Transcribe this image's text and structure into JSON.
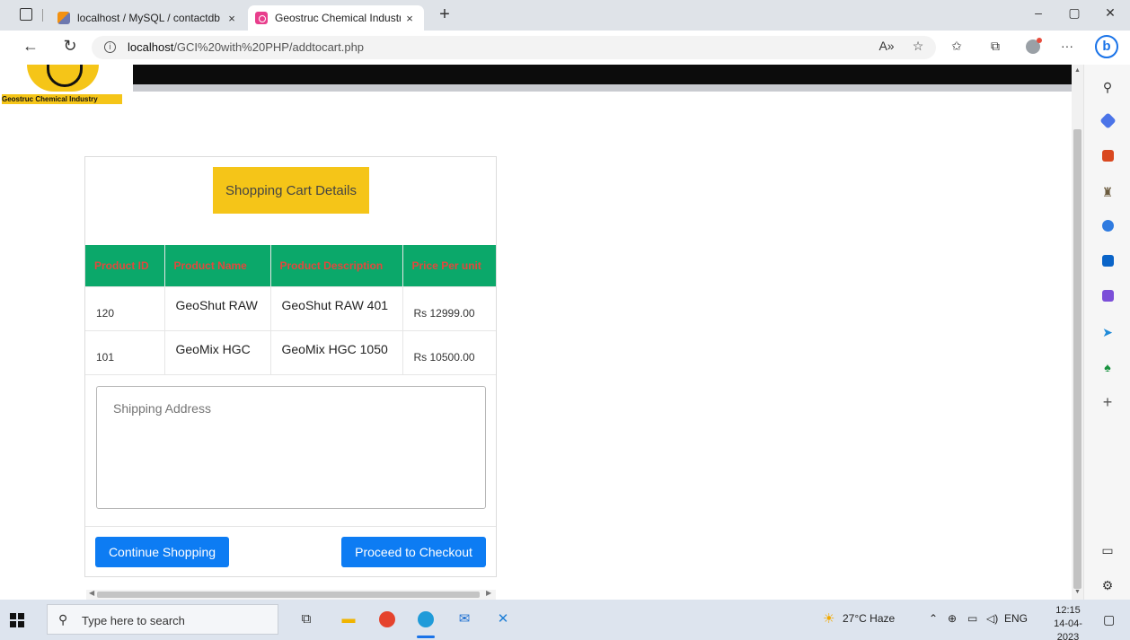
{
  "browser": {
    "tabs": [
      {
        "title": "localhost / MySQL / contactdb / ",
        "close": "×"
      },
      {
        "title": "Geostruc Chemical Industry",
        "close": "×"
      }
    ],
    "new_tab": "+",
    "window_controls": [
      "–",
      "▢",
      "✕"
    ],
    "url_host": "localhost",
    "url_path": "/GCI%20with%20PHP/addtocart.php",
    "more": "···"
  },
  "site": {
    "logo_text": "Geostruc Chemical Industry"
  },
  "cart": {
    "heading": "Shopping Cart Details",
    "columns": [
      "Product ID",
      "Product Name",
      "Product Description",
      "Price Per unit"
    ],
    "rows": [
      {
        "id": "120",
        "name": "GeoShut RAW",
        "description": "GeoShut RAW 401",
        "price": "Rs 12999.00"
      },
      {
        "id": "101",
        "name": "GeoMix HGC",
        "description": "GeoMix HGC 1050",
        "price": "Rs 10500.00"
      }
    ],
    "address_placeholder": "Shipping Address",
    "continue_label": "Continue Shopping",
    "checkout_label": "Proceed to Checkout"
  },
  "sidebar": {
    "icons": [
      "search-icon",
      "tag-icon",
      "briefcase-icon",
      "games-icon",
      "office-icon",
      "outlook-icon",
      "designer-icon",
      "send-icon",
      "tree-icon",
      "add-icon"
    ],
    "bottom_icons": [
      "panel-icon",
      "settings-icon"
    ]
  },
  "taskbar": {
    "search_placeholder": "Type here to search",
    "weather": "27°C  Haze",
    "language": "ENG",
    "time": "12:15",
    "date": "14-04-2023"
  },
  "colors": {
    "accent_yellow": "#f5c518",
    "table_header_green": "#0ba86a",
    "table_header_text": "#e3473d",
    "button_blue": "#0d7cf3"
  }
}
